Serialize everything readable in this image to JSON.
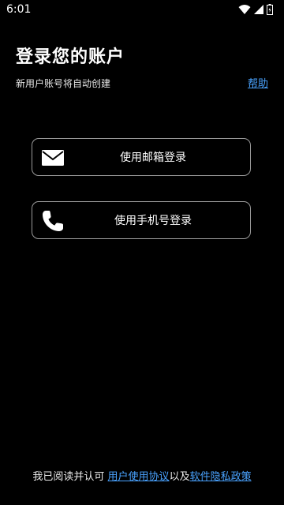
{
  "status_bar": {
    "time": "6:01",
    "icons": [
      "wifi-icon",
      "signal-icon",
      "battery-icon"
    ]
  },
  "header": {
    "title": "登录您的账户",
    "subtitle": "新用户账号将自动创建",
    "help_label": "帮助"
  },
  "login_options": {
    "email": {
      "label": "使用邮箱登录",
      "icon": "mail-icon"
    },
    "phone": {
      "label": "使用手机号登录",
      "icon": "phone-icon"
    }
  },
  "footer": {
    "prefix": "我已阅读并认可",
    "user_agreement": "用户使用协议",
    "connector": "以及",
    "privacy_policy": "软件隐私政策"
  },
  "colors": {
    "background": "#000000",
    "text": "#ffffff",
    "link": "#4aa3ff",
    "button_border": "#9a9a9a"
  }
}
